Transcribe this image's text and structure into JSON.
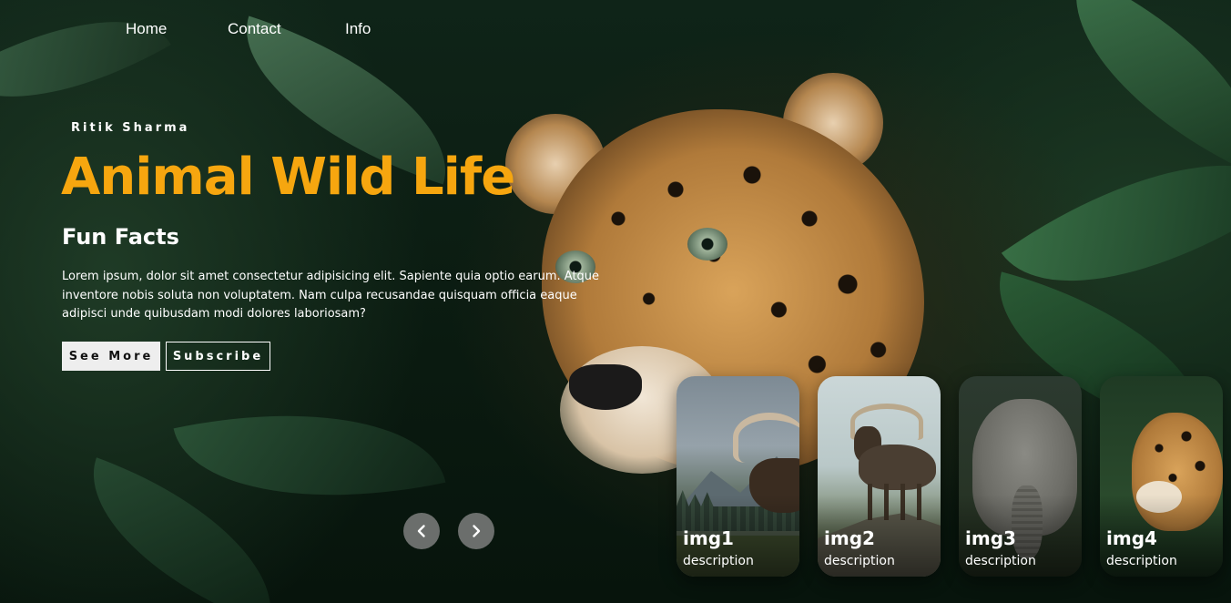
{
  "nav": {
    "items": [
      "Home",
      "Contact",
      "Info"
    ]
  },
  "hero": {
    "author": "Ritik Sharma",
    "title": "Animal Wild Life",
    "subtitle": "Fun Facts",
    "description": "Lorem ipsum, dolor sit amet consectetur adipisicing elit. Sapiente quia optio earum. Atque inventore nobis soluta non voluptatem. Nam culpa recusandae quisquam officia eaque adipisci unde quibusdam modi dolores laboriosam?",
    "primary_button": "See More",
    "secondary_button": "Subscribe",
    "accent_color": "#f6a60f"
  },
  "slider": {
    "prev_icon": "chevron-left-icon",
    "next_icon": "chevron-right-icon"
  },
  "cards": [
    {
      "title": "img1",
      "description": "description"
    },
    {
      "title": "img2",
      "description": "description"
    },
    {
      "title": "img3",
      "description": "description"
    },
    {
      "title": "img4",
      "description": "description"
    }
  ]
}
